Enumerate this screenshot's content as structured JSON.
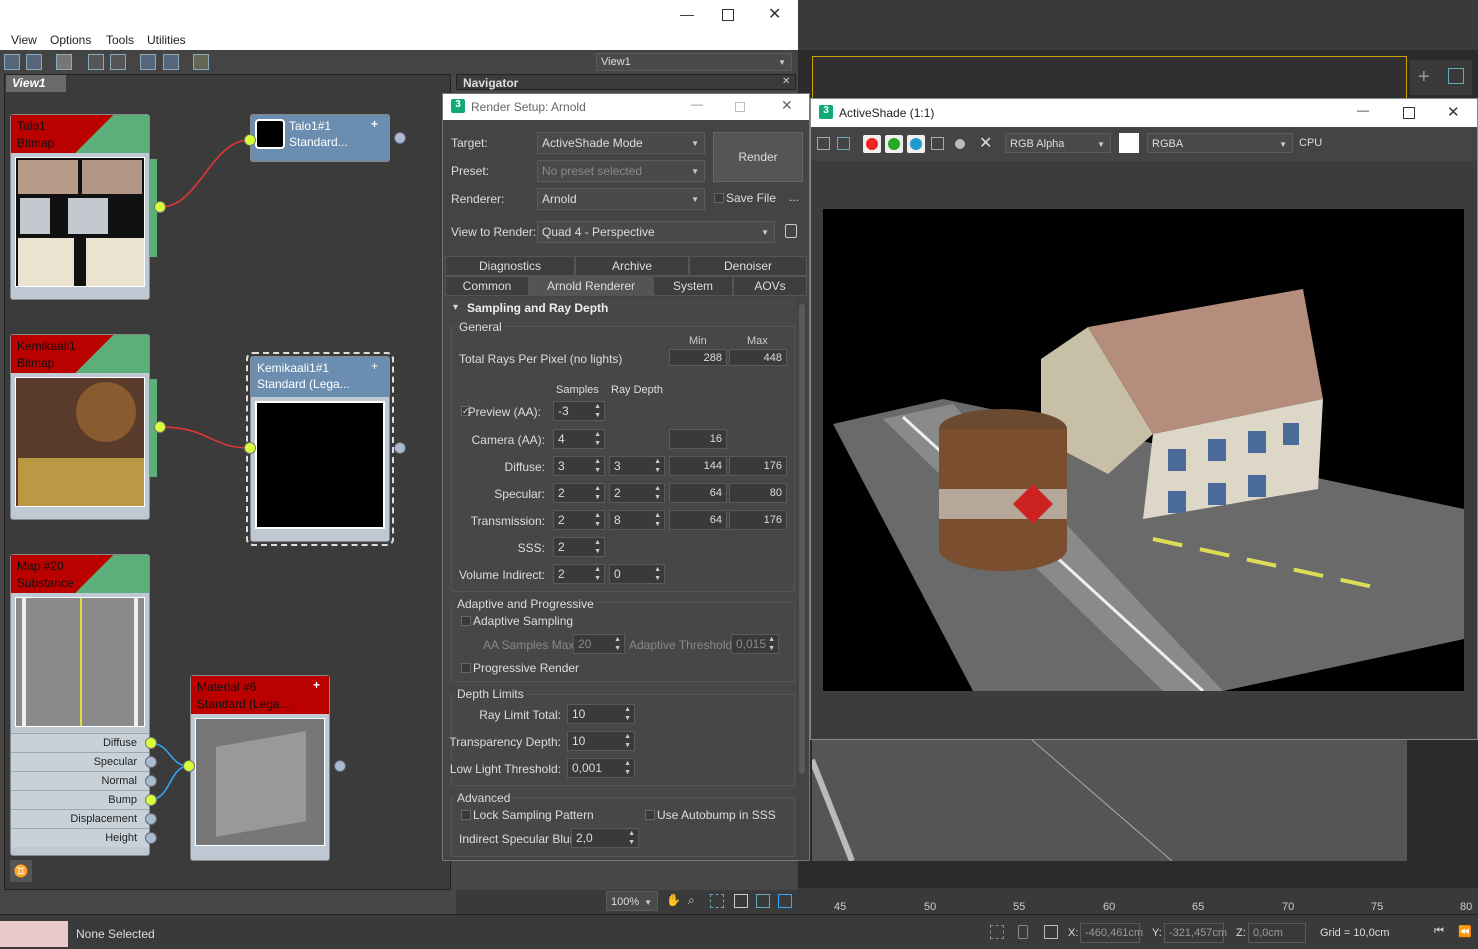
{
  "slate": {
    "menu": [
      "View",
      "Options",
      "Tools",
      "Utilities"
    ],
    "view_dropdown": "View1",
    "view_tab": "View1",
    "navigator_title": "Navigator",
    "nodes": {
      "talo_bitmap": {
        "line1": "Talo1",
        "line2": "Bitmap"
      },
      "talo_material": {
        "line1": "Talo1#1",
        "line2": "Standard..."
      },
      "kemi_bitmap": {
        "line1": "Kemikaali1",
        "line2": "Bitmap"
      },
      "kemi_material": {
        "line1": "Kemikaali1#1",
        "line2": "Standard  (Lega..."
      },
      "map20": {
        "line1": "Map #20",
        "line2": "Substance"
      },
      "material6": {
        "line1": "Material #6",
        "line2": "Standard  (Lega..."
      },
      "map20_props": [
        "Diffuse",
        "Specular",
        "Normal",
        "Bump",
        "Displacement",
        "Height"
      ]
    },
    "zoom": "100%"
  },
  "render_setup": {
    "title": "Render Setup: Arnold",
    "target_label": "Target:",
    "target_value": "ActiveShade Mode",
    "preset_label": "Preset:",
    "preset_value": "No preset selected",
    "renderer_label": "Renderer:",
    "renderer_value": "Arnold",
    "save_file": "Save File",
    "ellipsis": "...",
    "render_button": "Render",
    "view_label": "View to Render:",
    "view_value": "Quad 4 - Perspective",
    "tabs_row1": [
      "Diagnostics",
      "Archive",
      "Denoiser"
    ],
    "tabs_row2": [
      "Common",
      "Arnold Renderer",
      "System",
      "AOVs"
    ],
    "rollout_title": "Sampling and Ray Depth",
    "general": "General",
    "col_min": "Min",
    "col_max": "Max",
    "total_rays_label": "Total Rays Per Pixel (no lights)",
    "total_rays_min": "288",
    "total_rays_max": "448",
    "col_samples": "Samples",
    "col_ray_depth": "Ray Depth",
    "rows": [
      {
        "label": "Preview (AA):",
        "samples": "-3",
        "depth": "",
        "min": "",
        "max": ""
      },
      {
        "label": "Camera (AA):",
        "samples": "4",
        "depth": "",
        "min": "16",
        "max": ""
      },
      {
        "label": "Diffuse:",
        "samples": "3",
        "depth": "3",
        "min": "144",
        "max": "176"
      },
      {
        "label": "Specular:",
        "samples": "2",
        "depth": "2",
        "min": "64",
        "max": "80"
      },
      {
        "label": "Transmission:",
        "samples": "2",
        "depth": "8",
        "min": "64",
        "max": "176"
      },
      {
        "label": "SSS:",
        "samples": "2",
        "depth": "",
        "min": "",
        "max": ""
      },
      {
        "label": "Volume Indirect:",
        "samples": "2",
        "depth": "0",
        "min": "",
        "max": ""
      }
    ],
    "adaptive_title": "Adaptive and Progressive",
    "adaptive_sampling": "Adaptive Sampling",
    "aa_samples_max_label": "AA Samples Max:",
    "aa_samples_max": "20",
    "adaptive_threshold_label": "Adaptive Threshold:",
    "adaptive_threshold": "0,015",
    "progressive_render": "Progressive Render",
    "depth_limits_title": "Depth Limits",
    "ray_limit_label": "Ray Limit Total:",
    "ray_limit": "10",
    "transparency_label": "Transparency Depth:",
    "transparency": "10",
    "low_light_label": "Low Light Threshold:",
    "low_light": "0,001",
    "advanced_title": "Advanced",
    "lock_sampling": "Lock Sampling Pattern",
    "use_autobump": "Use Autobump in SSS",
    "indirect_blur_label": "Indirect Specular Blur:",
    "indirect_blur": "2,0"
  },
  "activeshade": {
    "title": "ActiveShade (1:1)",
    "channel": "RGB Alpha",
    "mode": "RGBA",
    "device": "CPU"
  },
  "status": {
    "selection": "None Selected",
    "x_label": "X:",
    "x_value": "-460,461cm",
    "y_label": "Y:",
    "y_value": "-321,457cm",
    "z_label": "Z:",
    "z_value": "0,0cm",
    "grid": "Grid = 10,0cm",
    "ticks": [
      "45",
      "50",
      "55",
      "60",
      "65",
      "70",
      "75",
      "80"
    ]
  },
  "colors": {
    "accent_red": "#b00000",
    "socket_yellow": "#d8ff3a",
    "panel": "#444444"
  }
}
